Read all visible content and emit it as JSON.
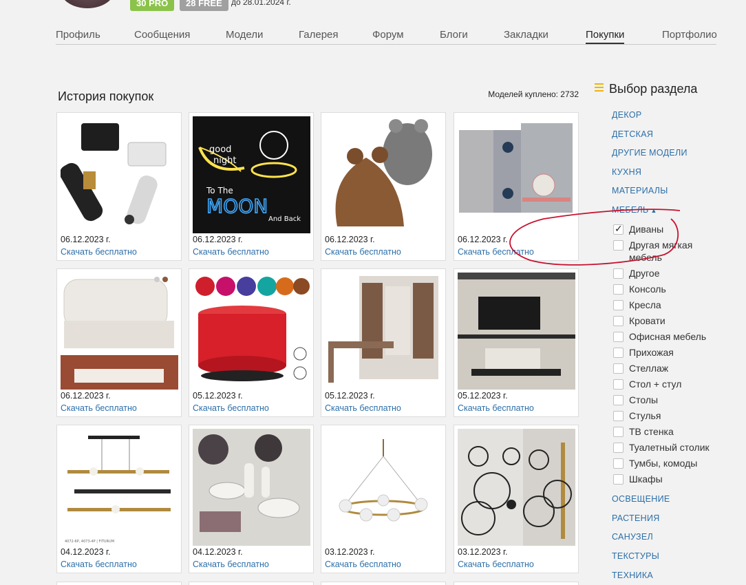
{
  "header": {
    "badge_pro": "30 PRO",
    "badge_free": "28 FREE",
    "expire_text": "до 28.01.2024 г."
  },
  "tabs": [
    {
      "label": "Профиль"
    },
    {
      "label": "Сообщения"
    },
    {
      "label": "Модели"
    },
    {
      "label": "Галерея"
    },
    {
      "label": "Форум"
    },
    {
      "label": "Блоги"
    },
    {
      "label": "Закладки"
    },
    {
      "label": "Покупки",
      "active": true
    },
    {
      "label": "Портфолио"
    }
  ],
  "main": {
    "title": "История покупок",
    "models_count": "Моделей куплено: 2732",
    "download_label": "Скачать бесплатно",
    "items": [
      {
        "date": "06.12.2023 г.",
        "image": "spot-lamp-image"
      },
      {
        "date": "06.12.2023 г.",
        "image": "neon-sign-image"
      },
      {
        "date": "06.12.2023 г.",
        "image": "bean-bag-image"
      },
      {
        "date": "06.12.2023 г.",
        "image": "wardrobe-image"
      },
      {
        "date": "06.12.2023 г.",
        "image": "bed-image"
      },
      {
        "date": "05.12.2023 г.",
        "image": "smart-speaker-image"
      },
      {
        "date": "05.12.2023 г.",
        "image": "cabinet-desk-image"
      },
      {
        "date": "05.12.2023 г.",
        "image": "tv-wall-image"
      },
      {
        "date": "04.12.2023 г.",
        "image": "pendant-lamp-image"
      },
      {
        "date": "04.12.2023 г.",
        "image": "table-decor-image"
      },
      {
        "date": "03.12.2023 г.",
        "image": "chandelier-image"
      },
      {
        "date": "03.12.2023 г.",
        "image": "wall-lamp-image"
      }
    ],
    "neon_text": {
      "good": "good",
      "night": "night",
      "to_the": "To The",
      "moon": "MOON",
      "and_back": "And Back"
    },
    "pendant_caption": "4072-6P, 4073-4P | FITURUM"
  },
  "sidebar": {
    "title": "Выбор раздела",
    "categories_top": [
      "ДЕКОР",
      "ДЕТСКАЯ",
      "ДРУГИЕ МОДЕЛИ",
      "КУХНЯ",
      "МАТЕРИАЛЫ",
      "МЕБЕЛЬ"
    ],
    "subcategories": [
      {
        "label": "Диваны",
        "checked": true
      },
      {
        "label": "Другая мягкая мебель",
        "checked": false
      },
      {
        "label": "Другое",
        "checked": false
      },
      {
        "label": "Консоль",
        "checked": false
      },
      {
        "label": "Кресла",
        "checked": false
      },
      {
        "label": "Кровати",
        "checked": false
      },
      {
        "label": "Офисная мебель",
        "checked": false
      },
      {
        "label": "Прихожая",
        "checked": false
      },
      {
        "label": "Стеллаж",
        "checked": false
      },
      {
        "label": "Стол + стул",
        "checked": false
      },
      {
        "label": "Столы",
        "checked": false
      },
      {
        "label": "Стулья",
        "checked": false
      },
      {
        "label": "ТВ стенка",
        "checked": false
      },
      {
        "label": "Туалетный столик",
        "checked": false
      },
      {
        "label": "Тумбы, комоды",
        "checked": false
      },
      {
        "label": "Шкафы",
        "checked": false
      }
    ],
    "categories_bottom": [
      "ОСВЕЩЕНИЕ",
      "РАСТЕНИЯ",
      "САНУЗЕЛ",
      "ТЕКСТУРЫ",
      "ТЕХНИКА"
    ],
    "annotation_color": "#c8102e"
  }
}
